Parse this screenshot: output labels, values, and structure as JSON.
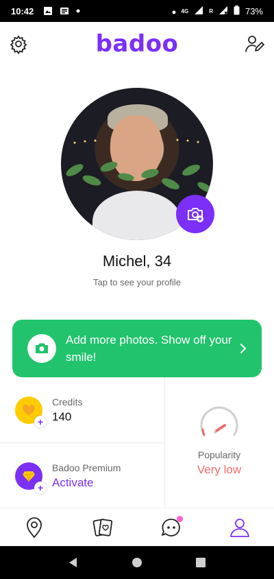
{
  "status_bar": {
    "time": "10:42",
    "network": "4G",
    "network2": "R",
    "battery": "73%"
  },
  "header": {
    "logo": "badoo"
  },
  "profile": {
    "name": "Michel, 34",
    "hint": "Tap to see your profile"
  },
  "promo": {
    "text": "Add more photos. Show off your smile!"
  },
  "credits": {
    "label": "Credits",
    "value": "140"
  },
  "premium": {
    "label": "Badoo Premium",
    "action": "Activate"
  },
  "popularity": {
    "label": "Popularity",
    "value": "Very low",
    "level": 0.15
  },
  "colors": {
    "brand": "#7b2ff7",
    "promo": "#22c36d",
    "credits": "#ffcc00",
    "premium": "#7b2ff7",
    "popularity_low": "#f26b6b",
    "notification": "#ff5fd2"
  },
  "nav": [
    "location-pin-icon",
    "cards-icon",
    "chat-icon",
    "profile-icon"
  ]
}
